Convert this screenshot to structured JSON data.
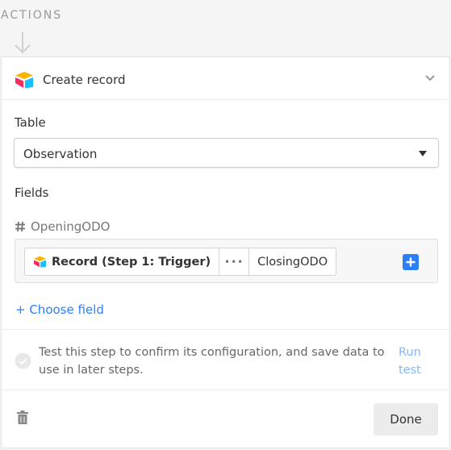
{
  "section": {
    "label": "ACTIONS"
  },
  "card": {
    "title": "Create record",
    "app_icon": "airtable-logo-icon",
    "collapse_icon": "chevron-down-icon"
  },
  "table": {
    "label": "Table",
    "selected": "Observation"
  },
  "fields": {
    "label": "Fields",
    "items": [
      {
        "type_icon": "hash-icon",
        "name": "OpeningODO",
        "token": {
          "source": "Record (Step 1: Trigger)",
          "separator": "•••",
          "value": "ClosingODO"
        }
      }
    ],
    "choose_label": "+ Choose field"
  },
  "test": {
    "message": "Test this step to confirm its configuration, and save data to use in later steps.",
    "run_label_line1": "Run",
    "run_label_line2": "test"
  },
  "footer": {
    "done_label": "Done",
    "delete_icon": "trash-icon"
  },
  "colors": {
    "accent": "#2d7ff9",
    "background": "#f5f5f5"
  }
}
